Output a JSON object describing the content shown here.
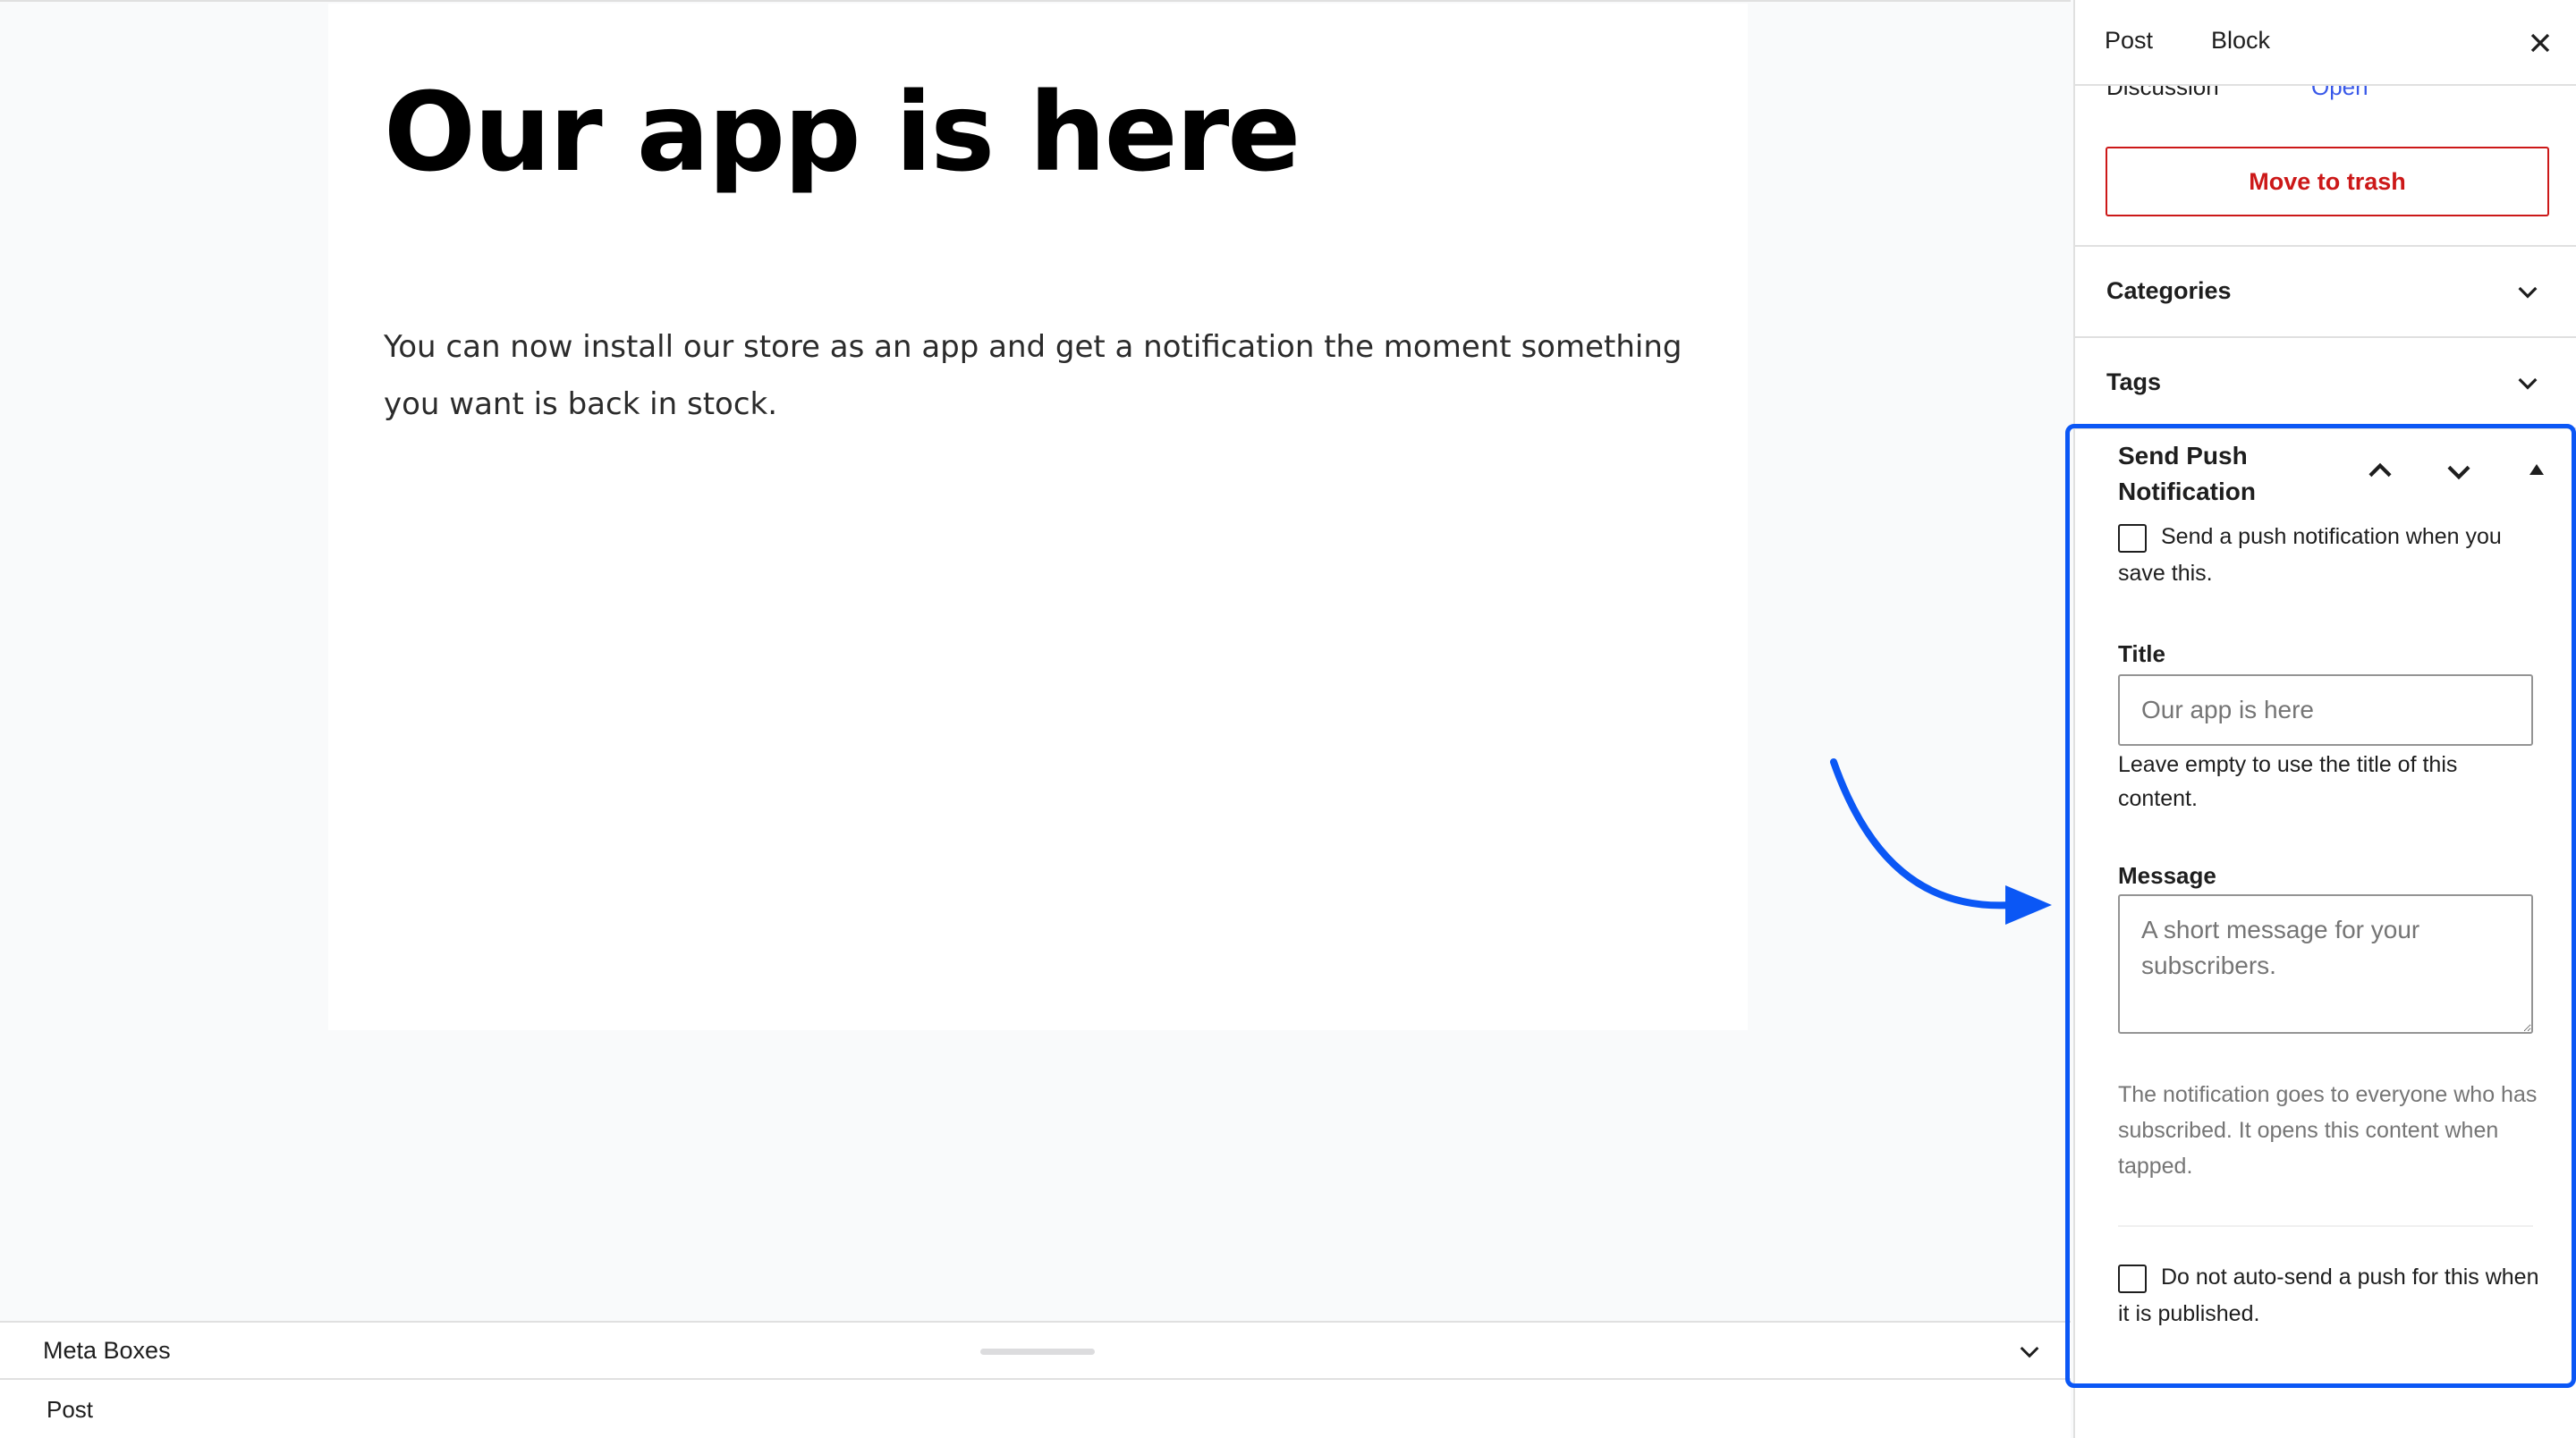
{
  "editor": {
    "post_title": "Our app is here",
    "post_body": "You can now install our store as an app and get a notification the moment something you want is back in stock."
  },
  "meta_boxes": {
    "label": "Meta Boxes",
    "post_label": "Post"
  },
  "sidebar": {
    "tabs": [
      {
        "label": "Post"
      },
      {
        "label": "Block"
      }
    ],
    "discussion": {
      "label": "Discussion",
      "value": "Open"
    },
    "trash_button": "Move to trash",
    "panels": [
      {
        "label": "Categories"
      },
      {
        "label": "Tags"
      }
    ],
    "push": {
      "title": "Send Push Notification",
      "send_on_save_label": "Send a push notification when you save this.",
      "title_field_label": "Title",
      "title_placeholder": "Our app is here",
      "title_help": "Leave empty to use the title of this content.",
      "message_field_label": "Message",
      "message_placeholder": "A short message for your subscribers.",
      "info": "The notification goes to everyone who has subscribed. It opens this content when tapped.",
      "no_autosend_label": "Do not auto-send a push for this when it is published."
    }
  },
  "colors": {
    "accent": "#3858e9",
    "danger": "#cc1818",
    "annotation": "#0b57f5"
  }
}
